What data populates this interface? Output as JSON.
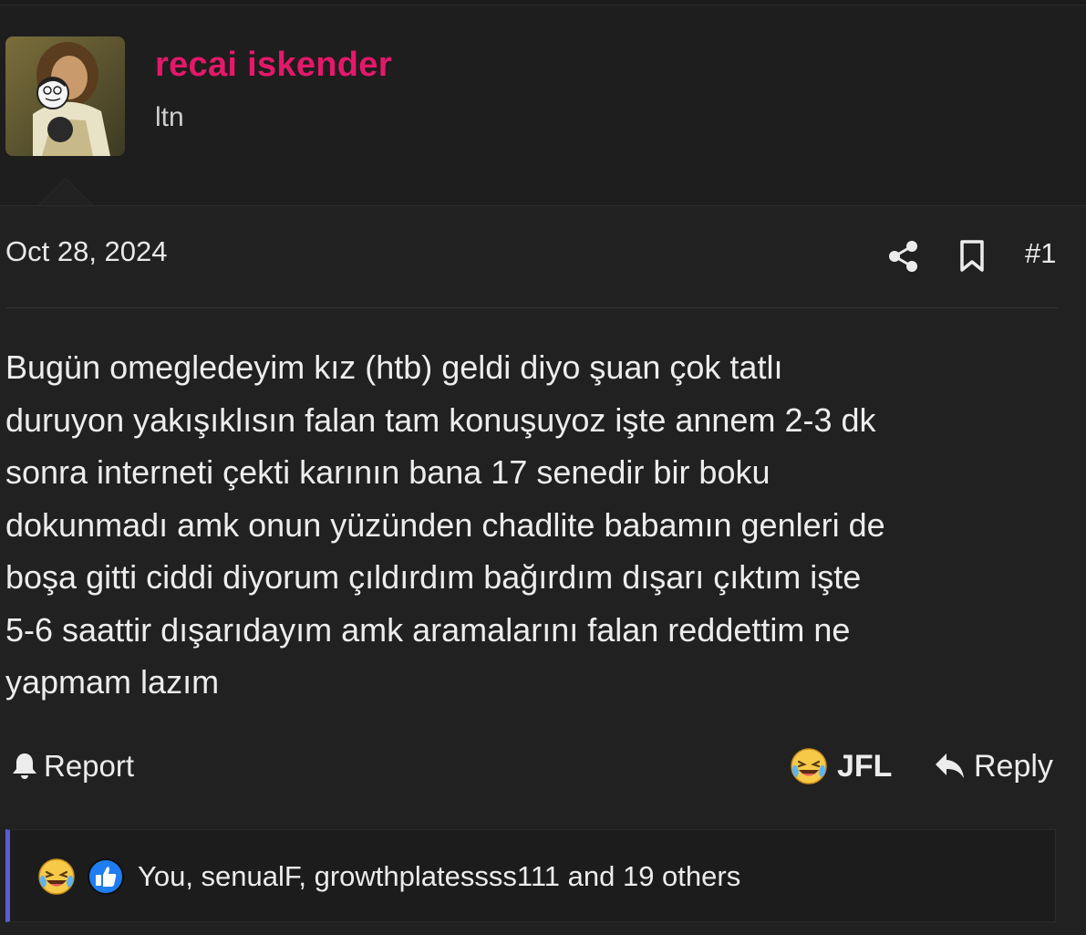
{
  "user": {
    "name": "recai iskender",
    "title": "ltn"
  },
  "post": {
    "date": "Oct 28, 2024",
    "number": "#1",
    "body": "Bugün omegledeyim kız (htb) geldi diyo şuan çok tatlı\nduruyon yakışıklısın falan tam konuşuyoz işte annem 2-3 dk\nsonra interneti çekti karının bana 17 senedir bir boku\ndokunmadı amk onun yüzünden chadlite babamın genleri de\nboşa gitti ciddi diyorum çıldırdım bağırdım dışarı çıktım işte\n5-6 saattir dışarıdayım amk aramalarını falan reddettim ne\nyapmam lazım"
  },
  "actions": {
    "report_label": "Report",
    "jfl_label": "JFL",
    "reply_label": "Reply"
  },
  "reactions": {
    "icons": [
      "laughing-crying-icon",
      "thumbs-up-icon"
    ],
    "summary": "You, senualF, growthplatessss111 and 19 others"
  },
  "colors": {
    "username": "#e5186a",
    "background": "#212121",
    "reaction_accent": "#5b5bd6"
  }
}
